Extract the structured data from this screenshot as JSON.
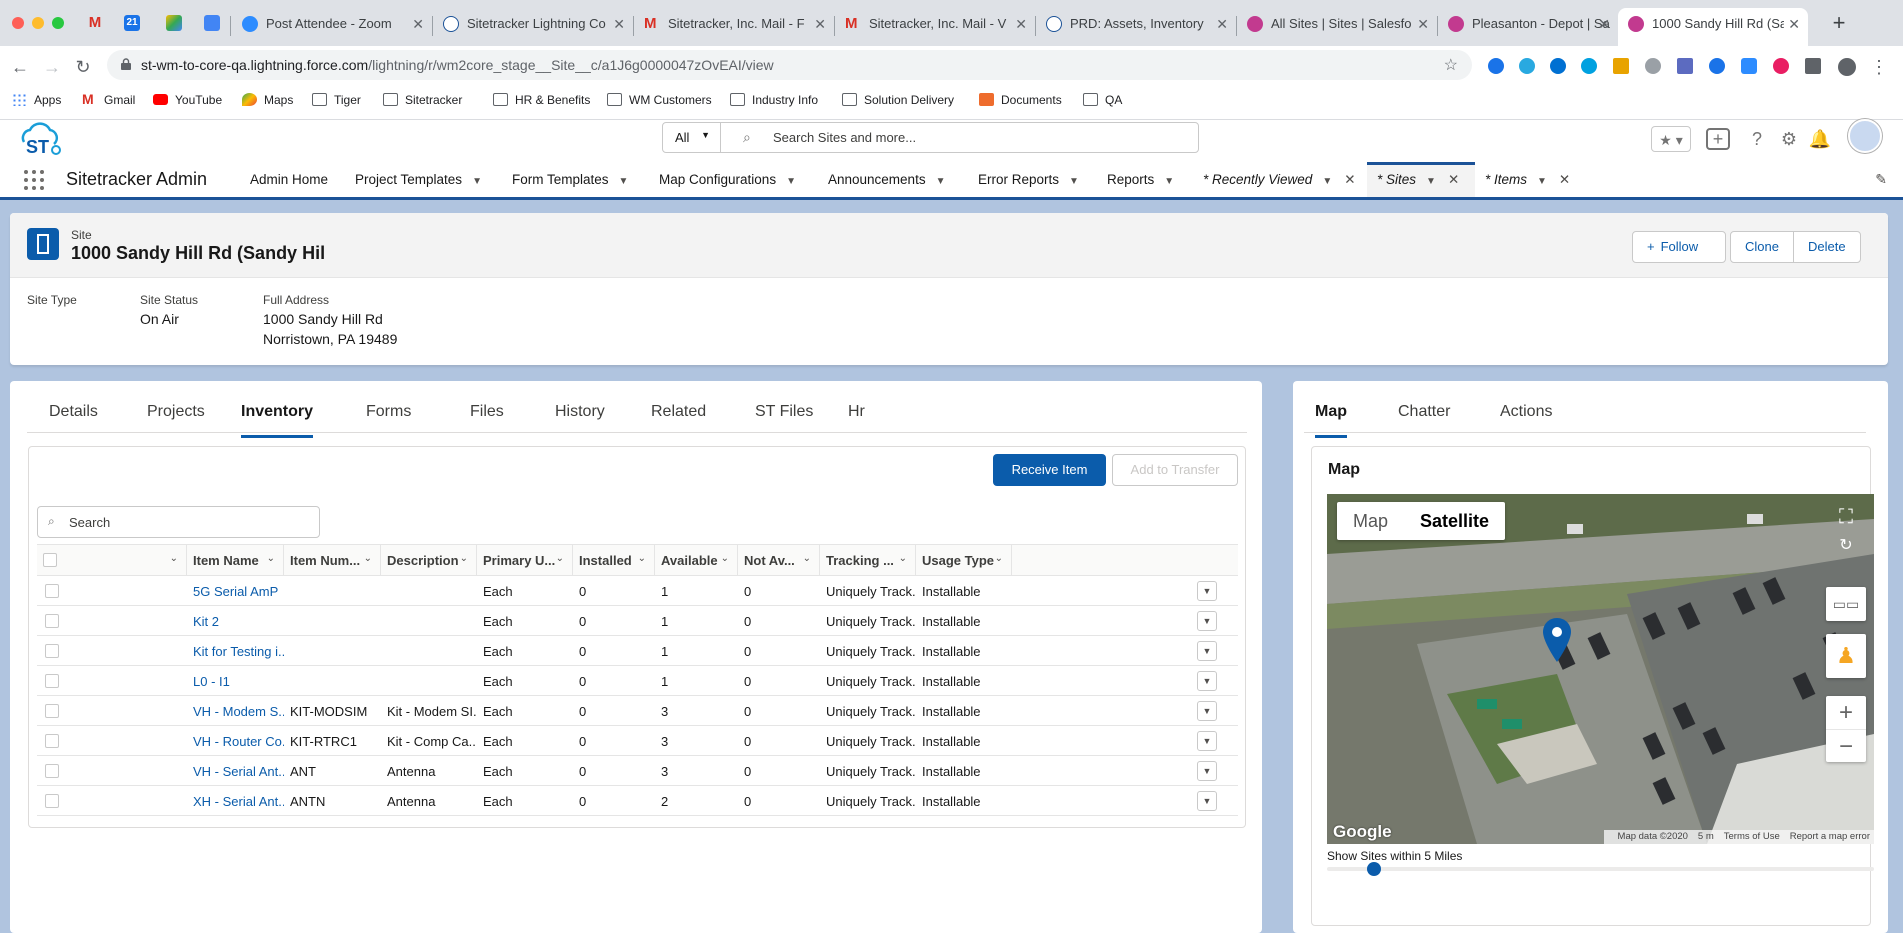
{
  "browser": {
    "tabs": [
      {
        "label": "Post Attendee - Zoom"
      },
      {
        "label": "Sitetracker Lightning Co"
      },
      {
        "label": "Sitetracker, Inc. Mail - F"
      },
      {
        "label": "Sitetracker, Inc. Mail - V"
      },
      {
        "label": "PRD: Assets, Inventory"
      },
      {
        "label": "All Sites | Sites | Salesfo"
      },
      {
        "label": "Pleasanton - Depot | Sa"
      },
      {
        "label": "1000 Sandy Hill Rd (San"
      }
    ],
    "pinned_calendar": "21",
    "url_host": "st-wm-to-core-qa.lightning.force.com",
    "url_path": "/lightning/r/wm2core_stage__Site__c/a1J6g0000047zOvEAI/view",
    "bookmarks": [
      "Apps",
      "Gmail",
      "YouTube",
      "Maps",
      "Tiger",
      "Sitetracker",
      "HR & Benefits",
      "WM Customers",
      "Industry Info",
      "Solution Delivery",
      "Documents",
      "QA"
    ]
  },
  "sf": {
    "search_scope": "All",
    "search_placeholder": "Search Sites and more...",
    "app_name": "Sitetracker Admin",
    "nav": [
      {
        "label": "Admin Home"
      },
      {
        "label": "Project Templates"
      },
      {
        "label": "Form Templates"
      },
      {
        "label": "Map Configurations"
      },
      {
        "label": "Announcements"
      },
      {
        "label": "Error Reports"
      },
      {
        "label": "Reports"
      },
      {
        "label": "* Recently Viewed"
      },
      {
        "label": "* Sites"
      },
      {
        "label": "* Items"
      }
    ]
  },
  "record": {
    "type": "Site",
    "title": "1000 Sandy Hill Rd (Sandy Hil",
    "actions": {
      "follow": "Follow",
      "clone": "Clone",
      "delete": "Delete"
    },
    "fields": {
      "site_type_label": "Site Type",
      "site_status_label": "Site Status",
      "site_status": "On Air",
      "address_label": "Full Address",
      "address_line1": "1000 Sandy Hill Rd",
      "address_line2": "Norristown, PA 19489"
    }
  },
  "left_tabs": [
    "Details",
    "Projects",
    "Inventory",
    "Forms",
    "Files",
    "History",
    "Related",
    "ST Files",
    "Hr"
  ],
  "inventory": {
    "receive_label": "Receive Item",
    "transfer_label": "Add to Transfer",
    "search_placeholder": "Search",
    "columns": [
      "Item Name",
      "Item Num...",
      "Description",
      "Primary U...",
      "Installed",
      "Available",
      "Not Av...",
      "Tracking ...",
      "Usage Type"
    ],
    "rows": [
      [
        "5G Serial AmP",
        "",
        "",
        "Each",
        "0",
        "1",
        "0",
        "Uniquely Track...",
        "Installable"
      ],
      [
        "Kit 2",
        "",
        "",
        "Each",
        "0",
        "1",
        "0",
        "Uniquely Track...",
        "Installable"
      ],
      [
        "Kit for Testing i...",
        "",
        "",
        "Each",
        "0",
        "1",
        "0",
        "Uniquely Track...",
        "Installable"
      ],
      [
        "L0 - I1",
        "",
        "",
        "Each",
        "0",
        "1",
        "0",
        "Uniquely Track...",
        "Installable"
      ],
      [
        "VH - Modem S...",
        "KIT-MODSIM",
        "Kit - Modem SI...",
        "Each",
        "0",
        "3",
        "0",
        "Uniquely Track...",
        "Installable"
      ],
      [
        "VH - Router Co...",
        "KIT-RTRC1",
        "Kit - Comp Ca...",
        "Each",
        "0",
        "3",
        "0",
        "Uniquely Track...",
        "Installable"
      ],
      [
        "VH - Serial Ant...",
        "ANT",
        "Antenna",
        "Each",
        "0",
        "3",
        "0",
        "Uniquely Track...",
        "Installable"
      ],
      [
        "XH - Serial Ant...",
        "ANTN",
        "Antenna",
        "Each",
        "0",
        "2",
        "0",
        "Uniquely Track...",
        "Installable"
      ]
    ]
  },
  "right_tabs": [
    "Map",
    "Chatter",
    "Actions"
  ],
  "map": {
    "title": "Map",
    "type_map": "Map",
    "type_satellite": "Satellite",
    "google": "Google",
    "attr_data": "Map data ©2020",
    "attr_scale": "5 m",
    "attr_terms": "Terms of Use",
    "attr_report": "Report a map error",
    "slider_label": "Show Sites within 5 Miles",
    "slider_value": 5
  },
  "colors": {
    "brand": "#0b5cab",
    "nav_border": "#1b5297",
    "background": "#b0c4df"
  }
}
